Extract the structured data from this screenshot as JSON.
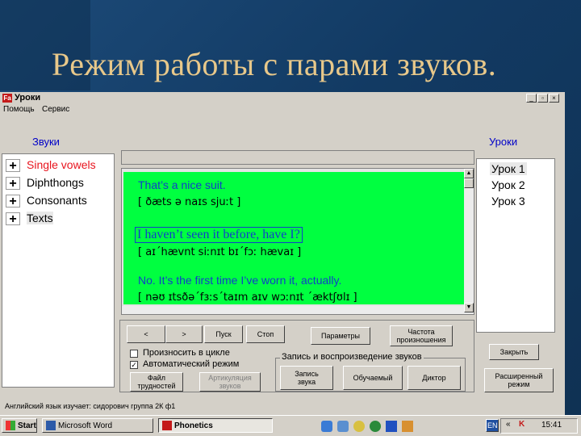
{
  "slide": {
    "title": "Режим работы с парами звуков."
  },
  "window": {
    "title": "Уроки",
    "app_icon": "Fa",
    "controls": [
      "_",
      "▫",
      "×"
    ]
  },
  "menu": [
    "Помощь",
    "Сервис"
  ],
  "labels": {
    "sounds": "Звуки",
    "lessons": "Уроки"
  },
  "sound_tree": [
    {
      "label": "Single vowels",
      "color": "#e8141e"
    },
    {
      "label": "Diphthongs",
      "color": "#000000"
    },
    {
      "label": "Consonants",
      "color": "#000000"
    },
    {
      "label": "Texts",
      "color": "#000000"
    }
  ],
  "dialogue": [
    {
      "sentence": "That’s a nice suit.",
      "transcription": "[ ðæts ə naɪs  sjuːt ]"
    },
    {
      "sentence": "I haven’t seen it before, have I?",
      "transcription": "[ aɪˊhævnt  siːnɪt bɪˊfɔː  hævaɪ ]"
    },
    {
      "sentence": "No. It’s the first time I’ve worn it, actually.",
      "transcription": "[ nəʊ ɪtsðəˊfɜːsˊtaɪm aɪv wɔːnɪt  ˊæktʃʊlɪ ]"
    }
  ],
  "lessons": [
    "Урок 1",
    "Урок 2",
    "Урок 3"
  ],
  "buttons": {
    "prev": "<",
    "next": ">",
    "start": "Пуск",
    "stop": "Стоп",
    "parameters": "Параметры",
    "frequency": "Частота\nпроизношения",
    "file": "Файл\nтрудностей",
    "articulation": "Артикуляция\nзвуков",
    "record": "Запись\nзвука",
    "trainee": "Обучаемый",
    "speaker": "Диктор",
    "close": "Закрыть",
    "extended": "Расширенный\nрежим"
  },
  "checkboxes": [
    {
      "label": "Произносить в цикле",
      "checked": false
    },
    {
      "label": "Автоматический режим",
      "checked": true
    }
  ],
  "group_title": "Запись и воспроизведение звуков",
  "status": "Английский язык изучает: сидорович группа 2К ф1",
  "taskbar": {
    "start": "Start",
    "tasks": [
      "Microsoft Word",
      "Phonetics"
    ],
    "lang": "EN",
    "clock": "15:41"
  }
}
